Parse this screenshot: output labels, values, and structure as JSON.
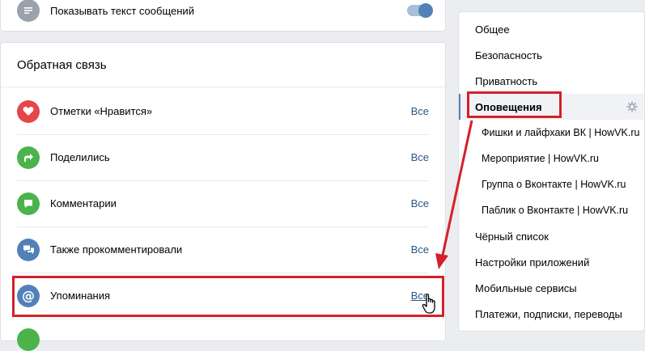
{
  "top_card": {
    "label": "Показывать текст сообщений",
    "toggle_state": "on"
  },
  "feedback": {
    "title": "Обратная связь",
    "rows": [
      {
        "label": "Отметки «Нравится»",
        "link": "Все",
        "icon": "heart-icon",
        "color": "#e64646"
      },
      {
        "label": "Поделились",
        "link": "Все",
        "icon": "share-icon",
        "color": "#4bb34b"
      },
      {
        "label": "Комментарии",
        "link": "Все",
        "icon": "comment-icon",
        "color": "#4bb34b"
      },
      {
        "label": "Также прокомментировали",
        "link": "Все",
        "icon": "comments-icon",
        "color": "#5181b8"
      },
      {
        "label": "Упоминания",
        "link": "Все",
        "icon": "mention-icon",
        "color": "#5181b8"
      }
    ]
  },
  "sidebar": {
    "items": [
      {
        "label": "Общее"
      },
      {
        "label": "Безопасность"
      },
      {
        "label": "Приватность"
      },
      {
        "label": "Оповещения",
        "active": true
      },
      {
        "label": "Фишки и лайфхаки ВК | HowVK.ru",
        "sub": true
      },
      {
        "label": "Мероприятие | HowVK.ru",
        "sub": true
      },
      {
        "label": "Группа о Вконтакте | HowVK.ru",
        "sub": true
      },
      {
        "label": "Паблик о Вконтакте | HowVK.ru",
        "sub": true
      },
      {
        "label": "Чёрный список"
      },
      {
        "label": "Настройки приложений"
      },
      {
        "label": "Мобильные сервисы"
      },
      {
        "label": "Платежи, подписки, переводы"
      }
    ]
  },
  "colors": {
    "accent": "#5181b8",
    "link": "#2a5885",
    "highlight": "#d4202a"
  }
}
